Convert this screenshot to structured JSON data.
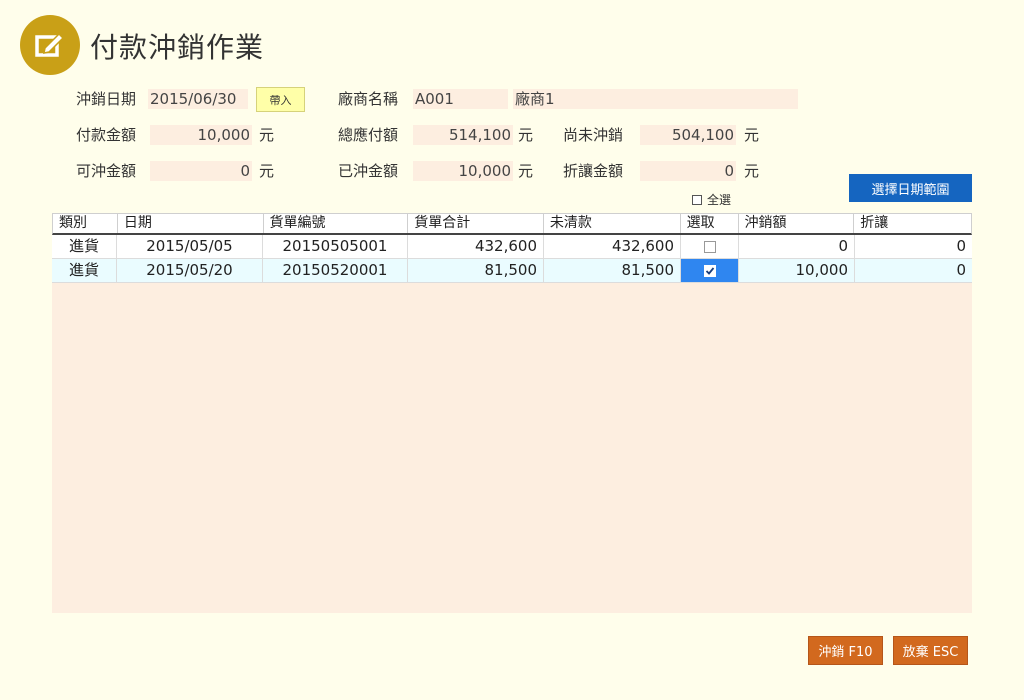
{
  "header": {
    "title": "付款沖銷作業",
    "icon": "edit-note-icon"
  },
  "form": {
    "date_label": "沖銷日期",
    "date_value": "2015/06/30",
    "import_label": "帶入",
    "vendor_label": "廠商名稱",
    "vendor_code": "A001",
    "vendor_name": "廠商1",
    "payment_label": "付款金額",
    "payment_value": "10,000",
    "total_payable_label": "總應付額",
    "total_payable_value": "514,100",
    "unwritten_label": "尚未沖銷",
    "unwritten_value": "504,100",
    "available_label": "可沖金額",
    "available_value": "0",
    "written_label": "已沖金額",
    "written_value": "10,000",
    "discount_label": "折讓金額",
    "discount_value": "0",
    "unit": "元",
    "select_all_label": "全選",
    "date_range_label": "選擇日期範圍"
  },
  "grid": {
    "columns": [
      "類別",
      "日期",
      "貨單編號",
      "貨單合計",
      "未清款",
      "選取",
      "沖銷額",
      "折讓"
    ],
    "rows": [
      {
        "type": "進貨",
        "date": "2015/05/05",
        "order_no": "20150505001",
        "total": "432,600",
        "outstanding": "432,600",
        "selected": false,
        "write_off": "0",
        "discount": "0"
      },
      {
        "type": "進貨",
        "date": "2015/05/20",
        "order_no": "20150520001",
        "total": "81,500",
        "outstanding": "81,500",
        "selected": true,
        "write_off": "10,000",
        "discount": "0"
      }
    ]
  },
  "actions": {
    "confirm_label": "沖銷 F10",
    "cancel_label": "放棄 ESC"
  },
  "colors": {
    "accent": "#c9a017",
    "primary_button": "#1565c0",
    "action_button": "#d2691e",
    "field_bg": "#fdeee0",
    "selected_cell": "#2f86f0"
  }
}
